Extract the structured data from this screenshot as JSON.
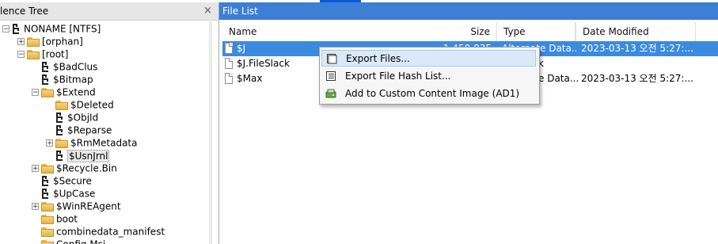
{
  "evidence_tree": {
    "title": "lence Tree",
    "close_label": "×",
    "nodes": [
      {
        "label": "NONAME [NTFS]",
        "icon": "tree-icon",
        "expander": "−",
        "depth": 0
      },
      {
        "label": "[orphan]",
        "icon": "folder-icon",
        "expander": "+",
        "depth": 1
      },
      {
        "label": "[root]",
        "icon": "folder-icon",
        "expander": "−",
        "depth": 1
      },
      {
        "label": "$BadClus",
        "icon": "tree-icon",
        "expander": "",
        "depth": 2
      },
      {
        "label": "$Bitmap",
        "icon": "tree-icon",
        "expander": "",
        "depth": 2
      },
      {
        "label": "$Extend",
        "icon": "folder-icon",
        "expander": "−",
        "depth": 2
      },
      {
        "label": "$Deleted",
        "icon": "folder-icon",
        "expander": "",
        "depth": 3
      },
      {
        "label": "$ObjId",
        "icon": "tree-icon",
        "expander": "",
        "depth": 3
      },
      {
        "label": "$Reparse",
        "icon": "tree-icon",
        "expander": "",
        "depth": 3
      },
      {
        "label": "$RmMetadata",
        "icon": "folder-icon",
        "expander": "+",
        "depth": 3
      },
      {
        "label": "$UsnJrnl",
        "icon": "tree-icon",
        "expander": "",
        "depth": 3,
        "selected": true
      },
      {
        "label": "$Recycle.Bin",
        "icon": "folder-icon",
        "expander": "+",
        "depth": 2
      },
      {
        "label": "$Secure",
        "icon": "tree-icon",
        "expander": "",
        "depth": 2
      },
      {
        "label": "$UpCase",
        "icon": "tree-icon",
        "expander": "",
        "depth": 2
      },
      {
        "label": "$WinREAgent",
        "icon": "folder-icon",
        "expander": "+",
        "depth": 2
      },
      {
        "label": "boot",
        "icon": "folder-icon",
        "expander": "",
        "depth": 2
      },
      {
        "label": "combinedata_manifest",
        "icon": "folder-icon",
        "expander": "",
        "depth": 2
      },
      {
        "label": "Config.Msi",
        "icon": "folder-icon",
        "expander": "",
        "depth": 2
      }
    ]
  },
  "file_list": {
    "title": "File List",
    "columns": [
      "Name",
      "Size",
      "Type",
      "Date Modified"
    ],
    "rows": [
      {
        "name": "$J",
        "size": "1,450,835",
        "type": "Alternate Data...",
        "date": "2023-03-13 오전 5:27:...",
        "selected": true
      },
      {
        "name": "$J.FileSlack",
        "size": "",
        "type": "k",
        "date": ""
      },
      {
        "name": "$Max",
        "size": "",
        "type": "e Data...",
        "date": "2023-03-13 오전 5:27:..."
      }
    ]
  },
  "context_menu": {
    "items": [
      {
        "label": "Export Files...",
        "icon": "export-files-icon"
      },
      {
        "label": "Export File Hash List...",
        "icon": "hash-list-icon"
      },
      {
        "label": "Add to Custom Content Image (AD1)",
        "icon": "add-image-icon"
      }
    ]
  }
}
